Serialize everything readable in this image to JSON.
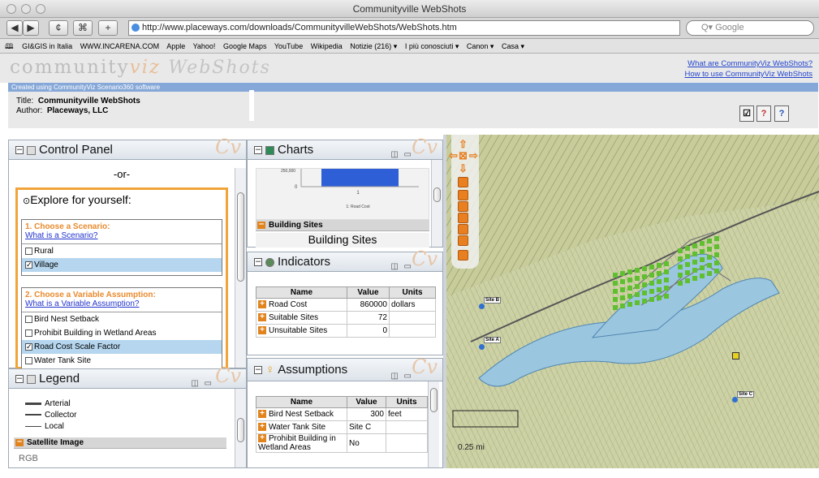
{
  "window": {
    "title": "Communityville WebShots"
  },
  "toolbar": {
    "back": "◀",
    "forward": "▶",
    "reload": "¢",
    "bookmark": "⌘",
    "add": "+",
    "url": "http://www.placeways.com/downloads/CommunityvilleWebShots/WebShots.htm",
    "search_placeholder": "Q▾ Google"
  },
  "bookmarks": {
    "book_icon": "🕮",
    "items": [
      "GI&GIS in Italia",
      "WWW.INCARENA.COM",
      "Apple",
      "Yahoo!",
      "Google Maps",
      "YouTube",
      "Wikipedia",
      "Notizie (216) ▾",
      "I più conosciuti ▾",
      "Canon ▾",
      "Casa ▾"
    ]
  },
  "header": {
    "logo_community": "community",
    "logo_viz": "viz",
    "logo_webshots": "WebShots",
    "link_what": "What are CommunityViz WebShots?",
    "link_how": "How to use CommunityViz WebShots",
    "created_using": "Created using CommunityViz Scenario360 software",
    "title_label": "Title:",
    "title_value": "Communityville WebShots",
    "author_label": "Author:",
    "author_value": "Placeways, LLC"
  },
  "control_panel": {
    "title": "Control Panel",
    "or": "-or-",
    "explore": "Explore for yourself:",
    "s1_heading": "1. Choose a Scenario:",
    "s1_link": "What is a Scenario?",
    "scenarios": [
      {
        "label": "Rural",
        "checked": false
      },
      {
        "label": "Village",
        "checked": true
      }
    ],
    "s2_heading": "2. Choose a Variable Assumption:",
    "s2_link": "What is a Variable Assumption?",
    "assumptions": [
      {
        "label": "Bird Nest Setback",
        "checked": false
      },
      {
        "label": "Prohibit Building in Wetland Areas",
        "checked": false
      },
      {
        "label": "Road Cost Scale Factor",
        "checked": true
      },
      {
        "label": "Water Tank Site",
        "checked": false
      }
    ]
  },
  "legend": {
    "title": "Legend",
    "items": [
      "Arterial",
      "Collector",
      "Local"
    ],
    "group": "Satellite Image",
    "cut_text": "RGB"
  },
  "charts": {
    "title": "Charts",
    "chart_data": {
      "type": "bar",
      "categories": [
        "1"
      ],
      "values": [
        250000
      ],
      "y_ticks": [
        "250,000",
        "0"
      ],
      "xlabel": "1: Road Cost"
    },
    "section": "Building Sites",
    "section_title": "Building Sites"
  },
  "indicators": {
    "title": "Indicators",
    "columns": [
      "Name",
      "Value",
      "Units"
    ],
    "rows": [
      {
        "name": "Road Cost",
        "value": "860000",
        "units": "dollars"
      },
      {
        "name": "Suitable Sites",
        "value": "72",
        "units": ""
      },
      {
        "name": "Unsuitable Sites",
        "value": "0",
        "units": ""
      }
    ]
  },
  "assumptions_panel": {
    "title": "Assumptions",
    "columns": [
      "Name",
      "Value",
      "Units"
    ],
    "rows": [
      {
        "name": "Bird Nest Setback",
        "value": "300",
        "units": "feet"
      },
      {
        "name": "Water Tank Site",
        "value": "Site C",
        "units": ""
      },
      {
        "name": "Prohibit Building in Wetland Areas",
        "value": "No",
        "units": ""
      }
    ]
  },
  "map": {
    "site_a": "Site A",
    "site_b": "Site B",
    "site_c": "Site C",
    "scale": "0.25 mi",
    "colors": {
      "terrain": "#c9cf9e",
      "wetland": "#9bc6e0",
      "sites": "#5fbf2f",
      "roads": "#555555"
    }
  }
}
